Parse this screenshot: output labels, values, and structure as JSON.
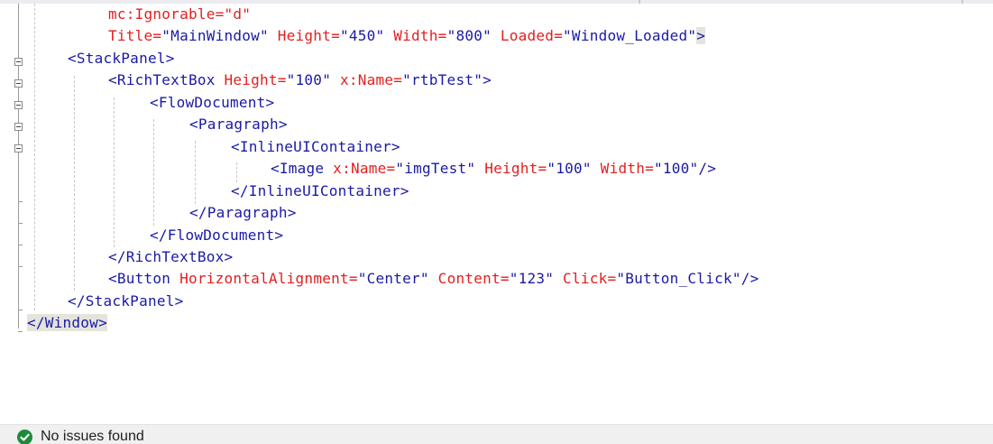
{
  "editor": {
    "lines": [
      [
        {
          "t": "mc:Ignorable=\"d\"",
          "c": "red"
        }
      ],
      [
        {
          "t": "Title=",
          "c": "red"
        },
        {
          "t": "\"MainWindow\"",
          "c": "blue"
        },
        {
          "t": " Height=",
          "c": "red"
        },
        {
          "t": "\"450\"",
          "c": "blue"
        },
        {
          "t": " Width=",
          "c": "red"
        },
        {
          "t": "\"800\"",
          "c": "blue"
        },
        {
          "t": " Loaded=",
          "c": "red"
        },
        {
          "t": "\"Window_Loaded\"",
          "c": "blue"
        },
        {
          "t": ">",
          "c": "blue",
          "hl": true
        }
      ],
      [
        {
          "t": "<StackPanel>",
          "c": "blue"
        }
      ],
      [
        {
          "t": "<RichTextBox",
          "c": "blue"
        },
        {
          "t": " Height=",
          "c": "red"
        },
        {
          "t": "\"100\"",
          "c": "blue"
        },
        {
          "t": " x:Name=",
          "c": "red"
        },
        {
          "t": "\"rtbTest\"",
          "c": "blue"
        },
        {
          "t": ">",
          "c": "blue"
        }
      ],
      [
        {
          "t": "<FlowDocument>",
          "c": "blue"
        }
      ],
      [
        {
          "t": "<Paragraph>",
          "c": "blue"
        }
      ],
      [
        {
          "t": "<InlineUIContainer>",
          "c": "blue"
        }
      ],
      [
        {
          "t": "<Image",
          "c": "blue"
        },
        {
          "t": " x:Name=",
          "c": "red"
        },
        {
          "t": "\"imgTest\"",
          "c": "blue"
        },
        {
          "t": " Height=",
          "c": "red"
        },
        {
          "t": "\"100\"",
          "c": "blue"
        },
        {
          "t": " Width=",
          "c": "red"
        },
        {
          "t": "\"100\"",
          "c": "blue"
        },
        {
          "t": "/>",
          "c": "blue"
        }
      ],
      [
        {
          "t": "</InlineUIContainer>",
          "c": "blue"
        }
      ],
      [
        {
          "t": "</Paragraph>",
          "c": "blue"
        }
      ],
      [
        {
          "t": "</FlowDocument>",
          "c": "blue"
        }
      ],
      [
        {
          "t": "</RichTextBox>",
          "c": "blue"
        }
      ],
      [
        {
          "t": "<Button",
          "c": "blue"
        },
        {
          "t": " HorizontalAlignment=",
          "c": "red"
        },
        {
          "t": "\"Center\"",
          "c": "blue"
        },
        {
          "t": " Content=",
          "c": "red"
        },
        {
          "t": "\"123\"",
          "c": "blue"
        },
        {
          "t": " Click=",
          "c": "red"
        },
        {
          "t": "\"Button_Click\"",
          "c": "blue"
        },
        {
          "t": "/>",
          "c": "blue"
        }
      ],
      [
        {
          "t": "</StackPanel>",
          "c": "blue"
        }
      ],
      [
        {
          "t": "</Window>",
          "c": "blue",
          "hl": true
        }
      ]
    ]
  },
  "status": {
    "text": "No issues found",
    "icon": "check-circle-icon",
    "icon_color": "#1e8a3a"
  }
}
